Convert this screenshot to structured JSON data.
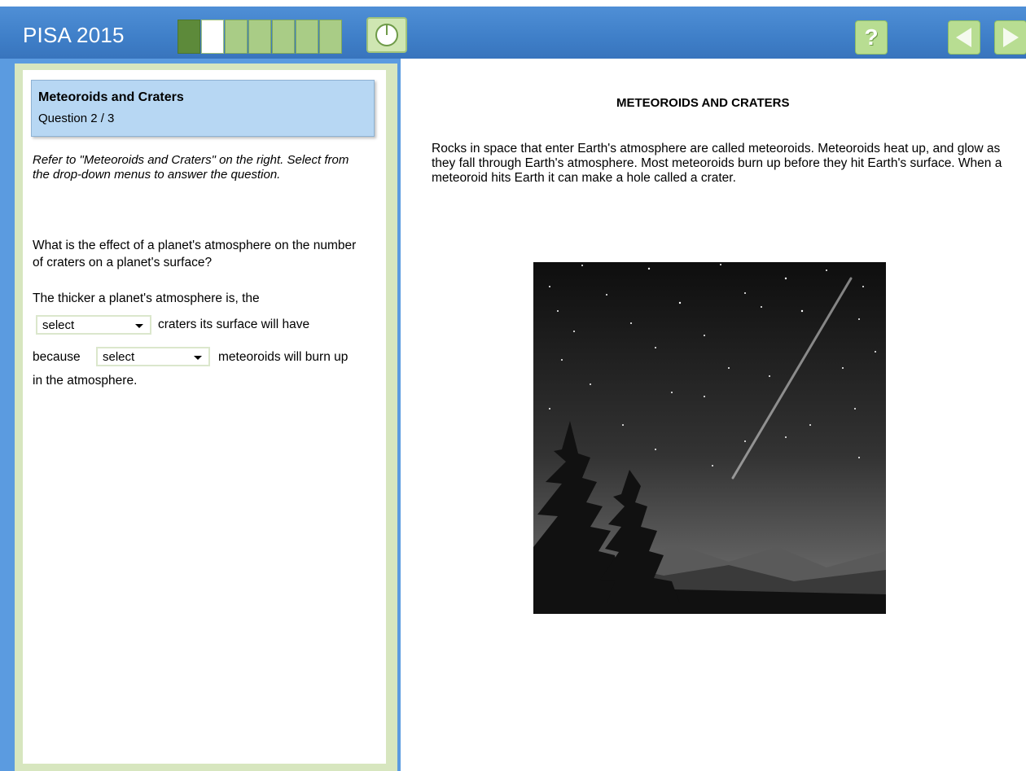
{
  "header": {
    "title": "PISA 2015",
    "progress": {
      "segments_total": 7,
      "completed": 1,
      "current": 2
    },
    "colors": {
      "bar": "#3f7fc8",
      "accent_green": "#b8dd92"
    },
    "buttons": {
      "timer": "timer-icon",
      "help": "?",
      "back": "back-arrow-icon",
      "next": "next-arrow-icon"
    }
  },
  "left": {
    "unit_title": "Meteoroids and Craters",
    "question_number": "Question 2 / 3",
    "instructions": "Refer to \"Meteoroids and Craters\" on the right. Select from the drop-down menus to answer the question.",
    "question": "What is the effect of a planet's atmosphere on the number of craters on a planet's surface?",
    "stem": "The thicker a planet's atmosphere is, the",
    "after_select_1": "craters its surface will have",
    "before_select_2": "because",
    "after_select_2": "meteoroids will burn up",
    "ending": "in the atmosphere.",
    "select_1": "select",
    "select_2": "select"
  },
  "right": {
    "title": "METEOROIDS AND CRATERS",
    "text": "Rocks in space that enter Earth's atmosphere are called meteoroids. Meteoroids heat up, and glow as they fall through Earth's atmosphere. Most meteoroids burn up before they hit Earth's surface. When a meteoroid hits Earth it can make a hole called a crater."
  }
}
